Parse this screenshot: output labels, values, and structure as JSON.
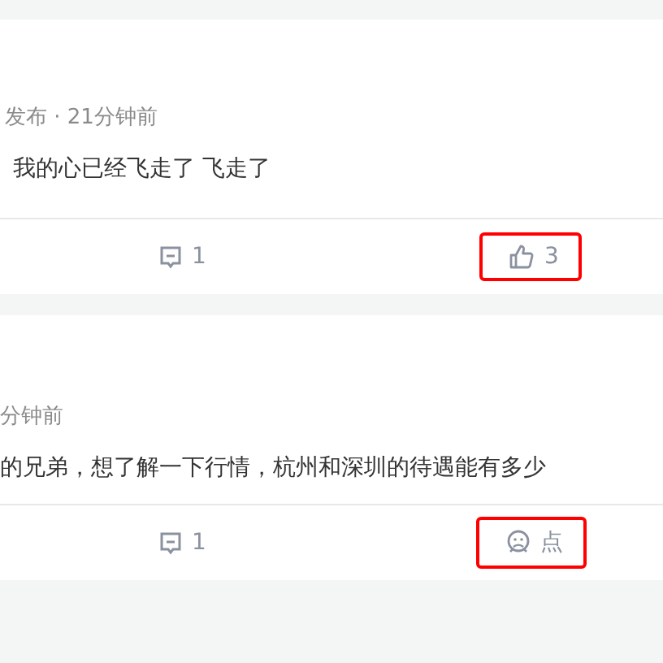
{
  "posts": [
    {
      "meta": "发布 · 21分钟前",
      "content": "我的心已经飞走了 飞走了",
      "comment_count": "1",
      "like": {
        "kind": "count",
        "text": "3",
        "highlighted": true
      }
    },
    {
      "meta": "分钟前",
      "content": "的兄弟，想了解一下行情，杭州和深圳的待遇能有多少",
      "comment_count": "1",
      "like": {
        "kind": "label",
        "text": "点",
        "highlighted": true
      }
    }
  ]
}
